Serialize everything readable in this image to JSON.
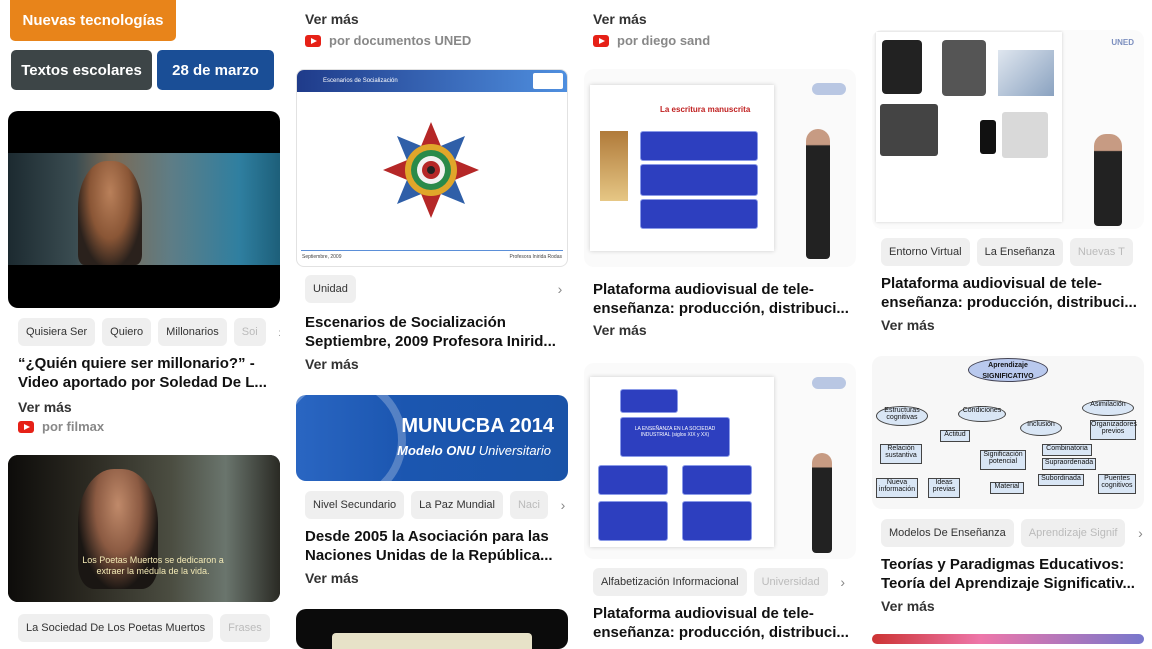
{
  "top_tags": {
    "nuevas": "Nuevas tecnologías",
    "textos": "Textos escolares",
    "fecha": "28 de marzo"
  },
  "colors": {
    "orange": "#e8841a",
    "dark_gray": "#3d4547",
    "navy": "#1a4e96",
    "youtube": "#e62117"
  },
  "col1": {
    "card1": {
      "tags": [
        "Quisiera Ser",
        "Quiero",
        "Millonarios",
        "Soi"
      ],
      "title": "“¿Quién quiere ser millonario?” - Video aportado por Soledad De L...",
      "more": "Ver más",
      "by": "por filmax"
    },
    "card2": {
      "subtitle_text": "Los Poetas Muertos se dedicaron a extraer la médula de la vida.",
      "tags": [
        "La Sociedad De Los Poetas Muertos",
        "Frases"
      ]
    }
  },
  "col2": {
    "top_more": "Ver más",
    "top_by": "por documentos UNED",
    "card1": {
      "slide_header": "Escenarios de Socialización",
      "slide_footer_left": "Septiembre, 2009",
      "slide_footer_right": "Profesora Inirida Rodas",
      "tags": [
        "Unidad"
      ],
      "title": "Escenarios de Socialización Septiembre, 2009 Profesora Inirid...",
      "more": "Ver más"
    },
    "card2": {
      "banner_title": "MUNUCBA 2014",
      "banner_sub_bold": "Modelo ONU",
      "banner_sub": " Universitario",
      "tags": [
        "Nivel Secundario",
        "La Paz Mundial",
        "Naci"
      ],
      "title": "Desde 2005 la Asociación para las Naciones Unidas de la República...",
      "more": "Ver más"
    }
  },
  "col3": {
    "top_more": "Ver más",
    "top_by": "por diego sand",
    "card1": {
      "slide_title": "La escritura manuscrita",
      "title": "Plataforma audiovisual de tele-enseñanza: producción, distribuci...",
      "more": "Ver más"
    },
    "card2": {
      "slide_center": "LA ENSEÑANZA EN LA SOCIEDAD INDUSTRIAL (siglos XIX y XX)",
      "tags": [
        "Alfabetización Informacional",
        "Universidad"
      ],
      "title": "Plataforma audiovisual de tele-enseñanza: producción, distribuci..."
    }
  },
  "col4": {
    "card1": {
      "logo": "UNED",
      "tags": [
        "Entorno Virtual",
        "La Enseñanza",
        "Nuevas T"
      ],
      "title": "Plataforma audiovisual de tele-enseñanza: producción, distribuci...",
      "more": "Ver más"
    },
    "card2": {
      "map_top": "Aprendizaje SIGNIFICATIVO",
      "nodes": [
        "Estructuras cognitivas",
        "Condiciones",
        "Inclusión",
        "Asimilación",
        "Actitud",
        "Relación sustantiva",
        "Significación potencial",
        "Organizadores previos",
        "Combinatoria",
        "Supraordenada",
        "Subordinada",
        "Nueva información",
        "Ideas previas",
        "Material",
        "Puentes cognitivos"
      ],
      "tags": [
        "Modelos De Enseñanza",
        "Aprendizaje Signif"
      ],
      "title": "Teorías y Paradigmas Educativos: Teoría del Aprendizaje Significativ...",
      "more": "Ver más"
    }
  }
}
